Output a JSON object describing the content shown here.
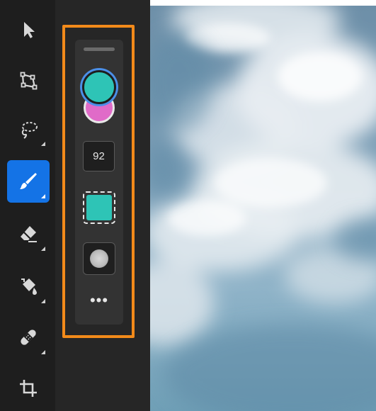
{
  "toolbar": {
    "tools": [
      {
        "name": "move-tool",
        "icon": "arrow-pointer-icon",
        "active": false
      },
      {
        "name": "transform-tool",
        "icon": "transform-icon",
        "active": false
      },
      {
        "name": "lasso-tool",
        "icon": "lasso-icon",
        "active": false
      },
      {
        "name": "brush-tool",
        "icon": "brush-icon",
        "active": true
      },
      {
        "name": "eraser-tool",
        "icon": "eraser-icon",
        "active": false
      },
      {
        "name": "fill-tool",
        "icon": "paint-bucket-icon",
        "active": false
      },
      {
        "name": "healing-tool",
        "icon": "bandage-icon",
        "active": false
      },
      {
        "name": "crop-tool",
        "icon": "crop-icon",
        "active": false
      }
    ]
  },
  "brush_options": {
    "foreground_color": "#2ec4b6",
    "background_color": "#e06bc8",
    "size_value": "92",
    "brush_color": "#2ec4b6",
    "softness_icon": "soft-circle-icon",
    "more_label": "•••"
  },
  "colors": {
    "accent": "#1473e6",
    "highlight": "#f28a1a"
  }
}
